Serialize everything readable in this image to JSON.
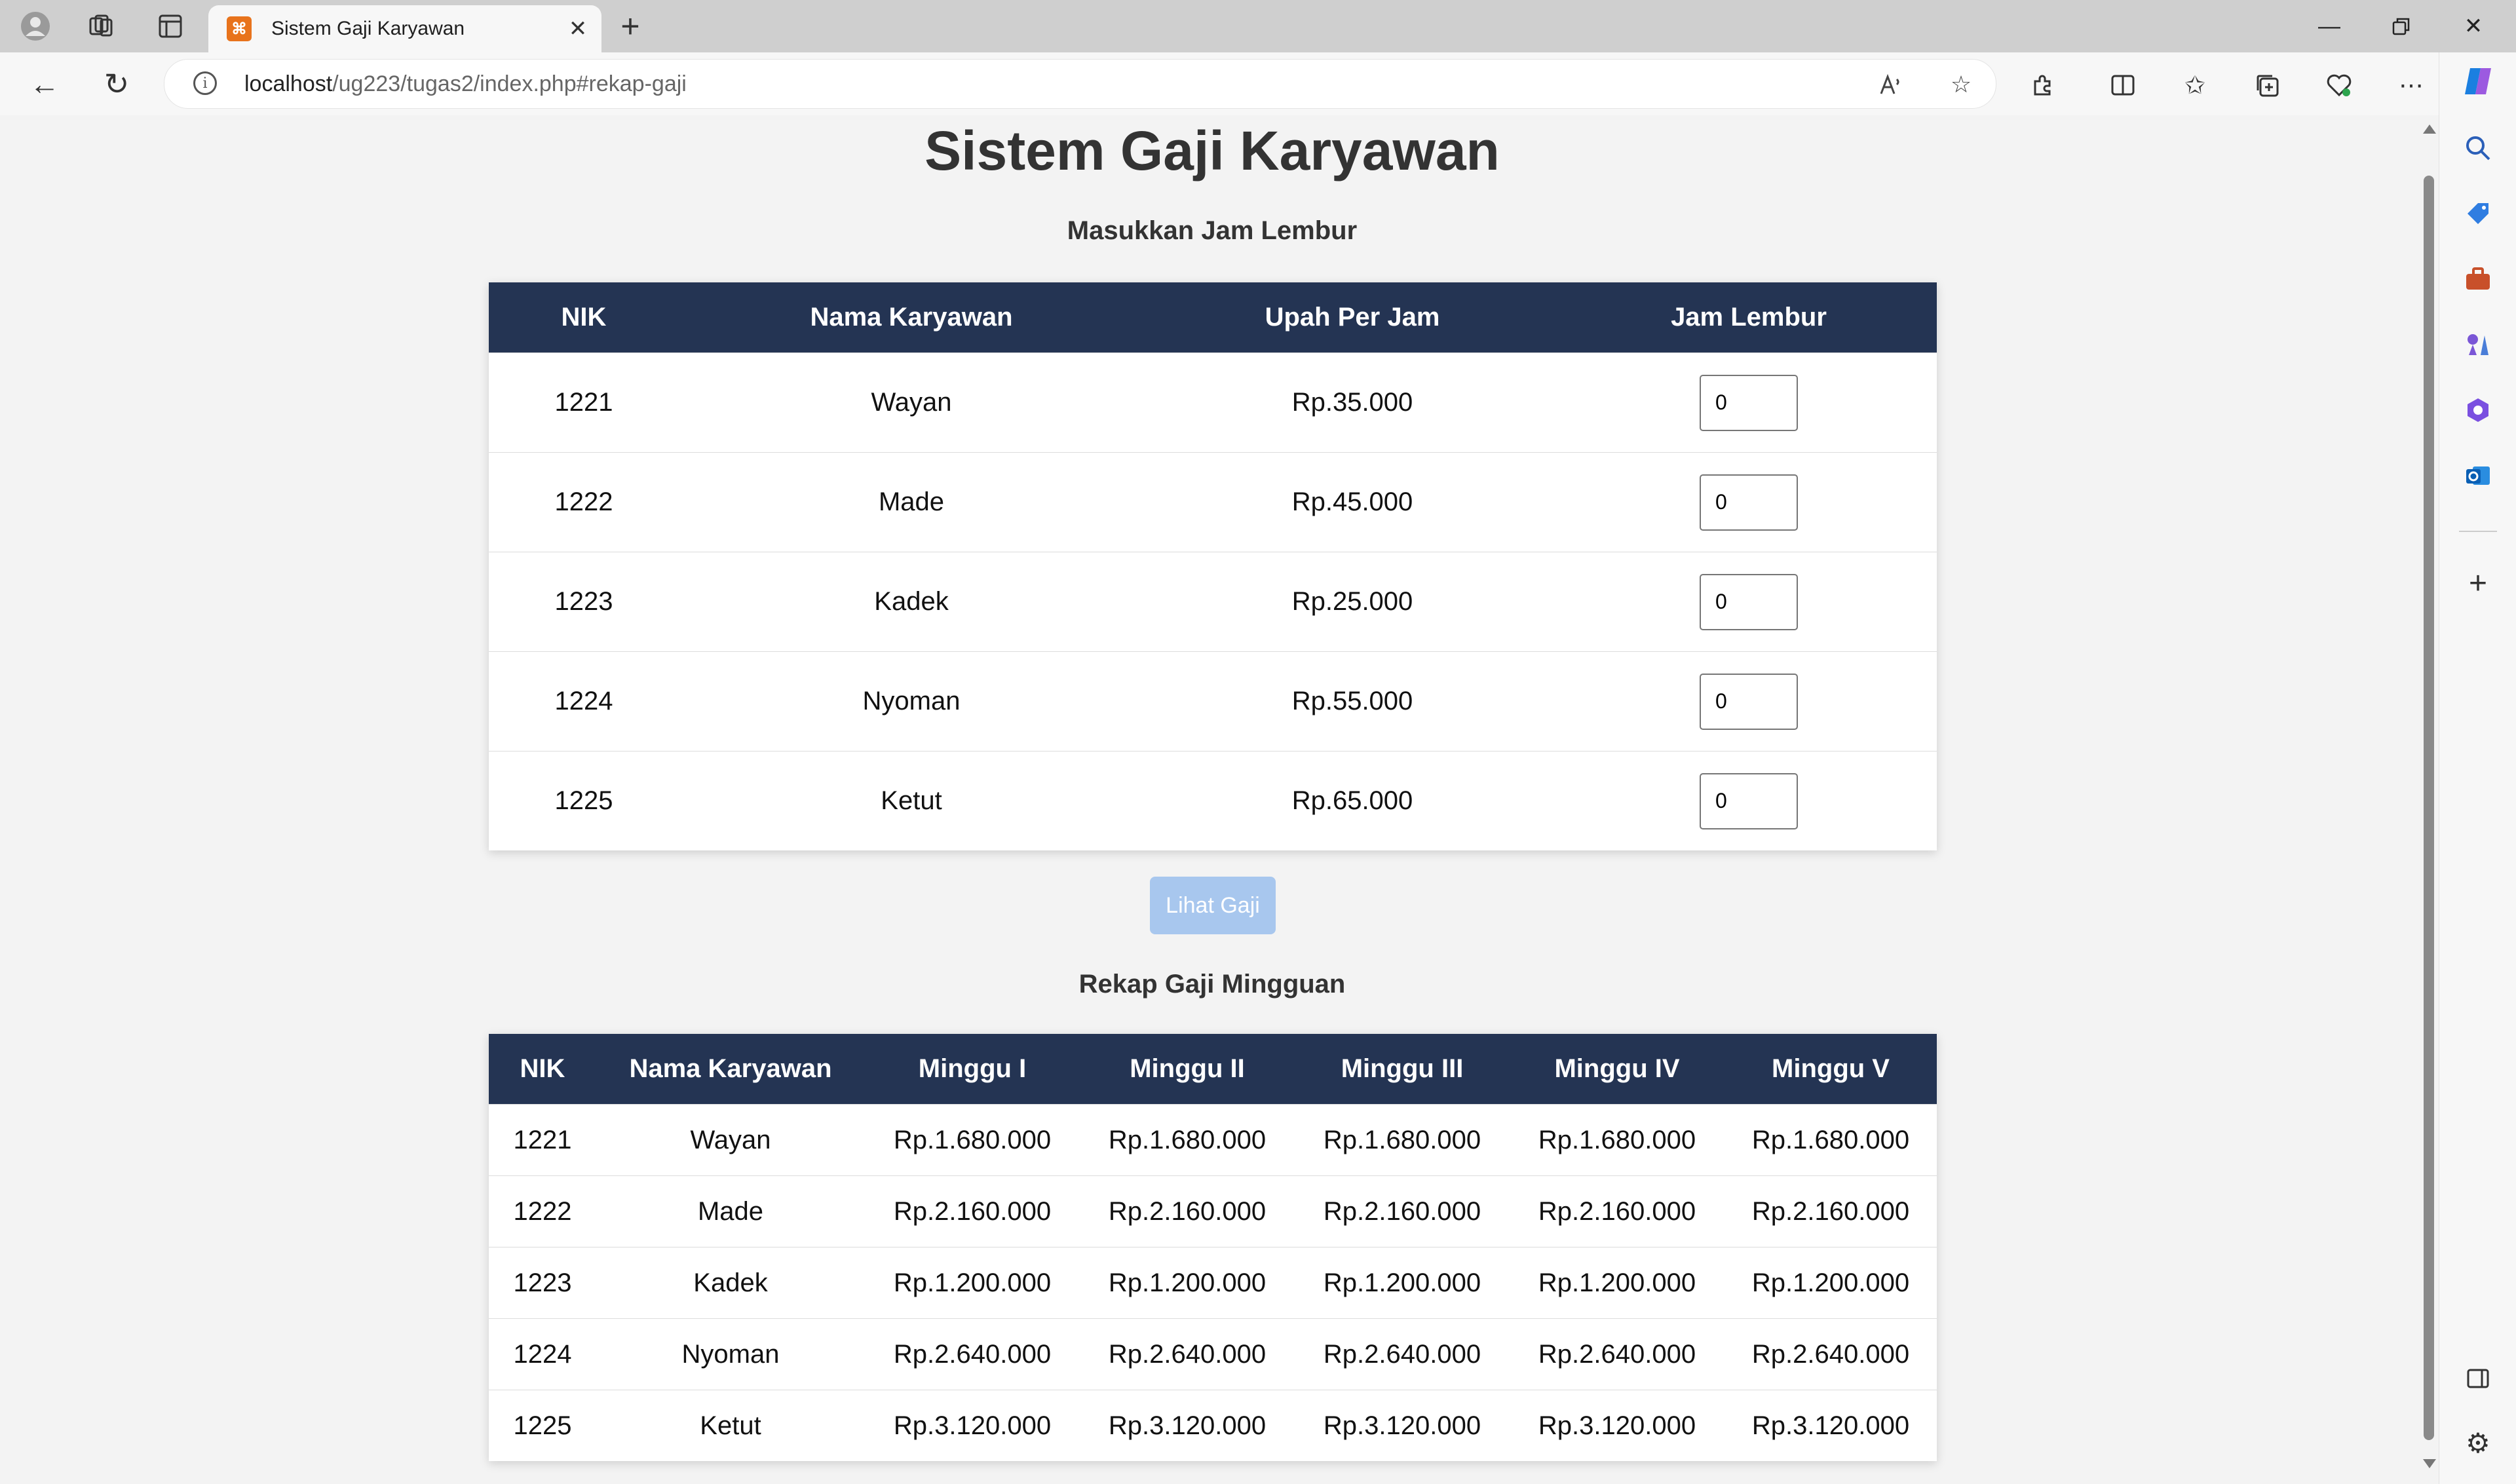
{
  "browser": {
    "tab_title": "Sistem Gaji Karyawan",
    "tab_favicon_glyph": "⌘",
    "url_host": "localhost",
    "url_path": "/ug223/tugas2/index.php#rekap-gaji",
    "icons": [
      "profile-icon",
      "workspaces-icon",
      "tab-actions-icon",
      "close-icon",
      "new-tab-icon",
      "back-icon",
      "reload-icon",
      "info-icon",
      "read-aloud-icon",
      "favorite-star-icon",
      "extensions-icon",
      "split-screen-icon",
      "favorites-icon",
      "collections-icon",
      "browser-essentials-icon",
      "more-icon",
      "copilot-icon",
      "search-icon",
      "shopping-icon",
      "tools-icon",
      "games-icon",
      "microsoft365-icon",
      "outlook-icon",
      "add-icon",
      "sidebar-toggle-icon",
      "settings-icon"
    ]
  },
  "page": {
    "title": "Sistem Gaji Karyawan",
    "input_section_title": "Masukkan Jam Lembur",
    "input_table": {
      "headers": [
        "NIK",
        "Nama Karyawan",
        "Upah Per Jam",
        "Jam Lembur"
      ],
      "rows": [
        {
          "nik": "1221",
          "nama": "Wayan",
          "upah": "Rp.35.000",
          "jam_lembur": "0"
        },
        {
          "nik": "1222",
          "nama": "Made",
          "upah": "Rp.45.000",
          "jam_lembur": "0"
        },
        {
          "nik": "1223",
          "nama": "Kadek",
          "upah": "Rp.25.000",
          "jam_lembur": "0"
        },
        {
          "nik": "1224",
          "nama": "Nyoman",
          "upah": "Rp.55.000",
          "jam_lembur": "0"
        },
        {
          "nik": "1225",
          "nama": "Ketut",
          "upah": "Rp.65.000",
          "jam_lembur": "0"
        }
      ]
    },
    "button_label": "Lihat Gaji",
    "recap_section_title": "Rekap Gaji Mingguan",
    "recap_table": {
      "headers": [
        "NIK",
        "Nama Karyawan",
        "Minggu I",
        "Minggu II",
        "Minggu III",
        "Minggu IV",
        "Minggu V"
      ],
      "rows": [
        [
          "1221",
          "Wayan",
          "Rp.1.680.000",
          "Rp.1.680.000",
          "Rp.1.680.000",
          "Rp.1.680.000",
          "Rp.1.680.000"
        ],
        [
          "1222",
          "Made",
          "Rp.2.160.000",
          "Rp.2.160.000",
          "Rp.2.160.000",
          "Rp.2.160.000",
          "Rp.2.160.000"
        ],
        [
          "1223",
          "Kadek",
          "Rp.1.200.000",
          "Rp.1.200.000",
          "Rp.1.200.000",
          "Rp.1.200.000",
          "Rp.1.200.000"
        ],
        [
          "1224",
          "Nyoman",
          "Rp.2.640.000",
          "Rp.2.640.000",
          "Rp.2.640.000",
          "Rp.2.640.000",
          "Rp.2.640.000"
        ],
        [
          "1225",
          "Ketut",
          "Rp.3.120.000",
          "Rp.3.120.000",
          "Rp.3.120.000",
          "Rp.3.120.000",
          "Rp.3.120.000"
        ]
      ]
    }
  },
  "colors": {
    "table_header": "#243453",
    "button_bg": "#a8c7ee",
    "page_bg": "#f3f3f3"
  }
}
